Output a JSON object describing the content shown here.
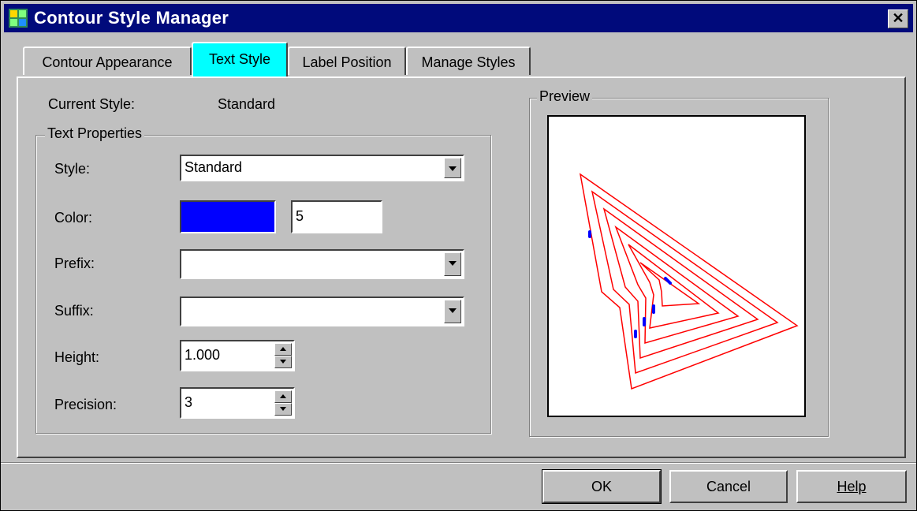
{
  "window": {
    "title": "Contour Style Manager",
    "close_label": "✕",
    "app_icon": "contour-app-icon",
    "title_bar_color": "#000a7b"
  },
  "tabs": [
    {
      "label": "Contour Appearance",
      "active": false
    },
    {
      "label": "Text Style",
      "active": true
    },
    {
      "label": "Label Position",
      "active": false
    },
    {
      "label": "Manage Styles",
      "active": false
    }
  ],
  "current_style": {
    "label": "Current Style:",
    "value": "Standard"
  },
  "text_properties": {
    "title": "Text Properties",
    "style": {
      "label": "Style:",
      "value": "Standard"
    },
    "color": {
      "label": "Color:",
      "swatch": "#0000ff",
      "value": "5"
    },
    "prefix": {
      "label": "Prefix:",
      "value": ""
    },
    "suffix": {
      "label": "Suffix:",
      "value": ""
    },
    "height": {
      "label": "Height:",
      "value": "1.000"
    },
    "precision": {
      "label": "Precision:",
      "value": "3"
    }
  },
  "preview": {
    "title": "Preview",
    "line_color": "#ff0000",
    "label_color": "#0000ff"
  },
  "buttons": {
    "ok": "OK",
    "cancel": "Cancel",
    "help": "Help"
  }
}
